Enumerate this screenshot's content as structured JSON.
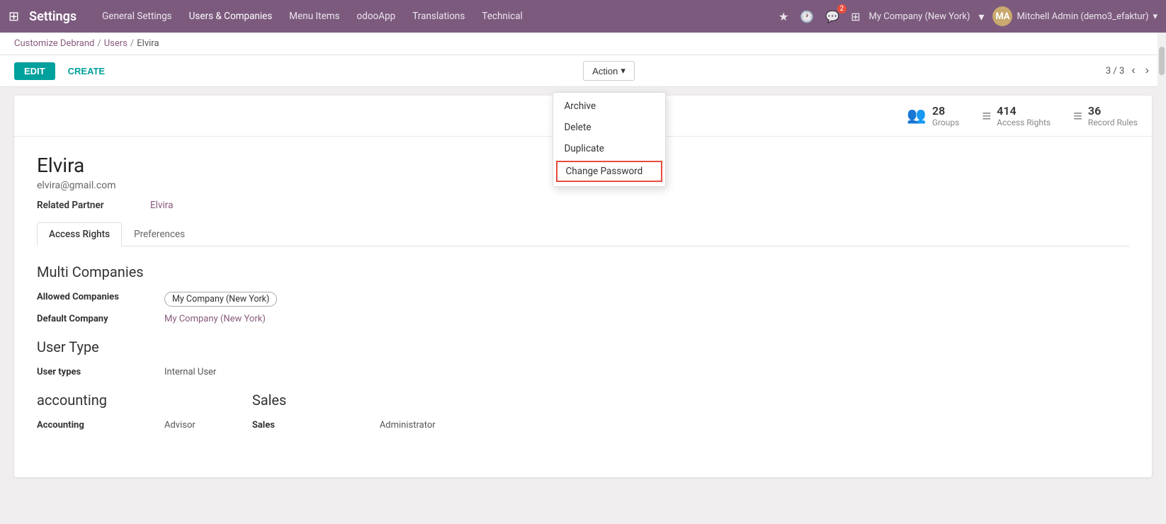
{
  "topbar": {
    "brand": "Settings",
    "nav_items": [
      {
        "label": "General Settings",
        "active": false
      },
      {
        "label": "Users & Companies",
        "active": true
      },
      {
        "label": "Menu Items",
        "active": false
      },
      {
        "label": "odooApp",
        "active": false
      },
      {
        "label": "Translations",
        "active": false
      },
      {
        "label": "Technical",
        "active": false
      }
    ],
    "company": "My Company (New York)",
    "user": "Mitchell Admin (demo3_efaktur)",
    "notification_count": "2"
  },
  "breadcrumb": {
    "items": [
      "Customize Debrand",
      "Users",
      "Elvira"
    ],
    "links": [
      true,
      true,
      false
    ]
  },
  "toolbar": {
    "edit_label": "EDIT",
    "create_label": "CREATE",
    "action_label": "Action",
    "action_dropdown": "▾",
    "pagination": "3 / 3"
  },
  "action_menu": {
    "items": [
      {
        "label": "Archive",
        "highlighted": false
      },
      {
        "label": "Delete",
        "highlighted": false
      },
      {
        "label": "Duplicate",
        "highlighted": false
      },
      {
        "label": "Change Password",
        "highlighted": true
      }
    ]
  },
  "stats": [
    {
      "icon": "👥",
      "number": "28",
      "label": "Groups"
    },
    {
      "icon": "≡",
      "number": "414",
      "label": "Access Rights"
    },
    {
      "icon": "≡",
      "number": "36",
      "label": "Record Rules"
    }
  ],
  "user": {
    "name": "Elvira",
    "email": "elvira@gmail.com",
    "related_partner_label": "Related Partner",
    "related_partner_value": "Elvira"
  },
  "tabs": [
    {
      "label": "Access Rights",
      "active": true
    },
    {
      "label": "Preferences",
      "active": false
    }
  ],
  "access_rights": {
    "multi_companies_title": "Multi Companies",
    "allowed_companies_label": "Allowed Companies",
    "allowed_companies_value": "My Company (New York)",
    "default_company_label": "Default Company",
    "default_company_value": "My Company (New York)",
    "user_type_title": "User Type",
    "user_types_label": "User types",
    "user_types_value": "Internal User",
    "accounting_title": "accounting",
    "accounting_label": "Accounting",
    "accounting_value": "Advisor",
    "sales_title": "Sales",
    "sales_label": "Sales",
    "sales_value": "Administrator"
  }
}
